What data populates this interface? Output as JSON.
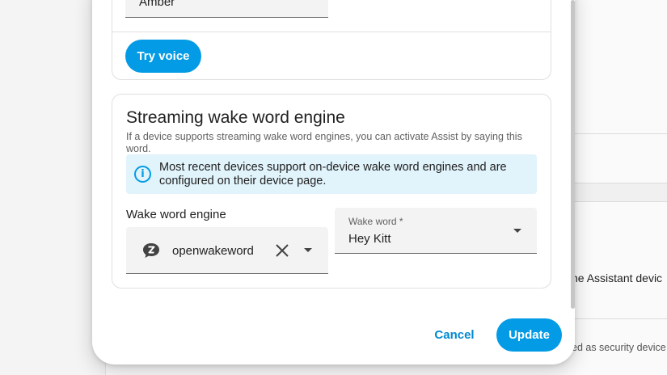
{
  "background": {
    "text_device": "ne Assistant devic",
    "text_security": "ed as security device"
  },
  "voice_section": {
    "voice_value": "Amber",
    "try_voice_label": "Try voice"
  },
  "wake_section": {
    "title": "Streaming wake word engine",
    "description": "If a device supports streaming wake word engines, you can activate Assist by saying this word.",
    "info_text": "Most recent devices support on-device wake word engines and are configured on their device page.",
    "engine_label": "Wake word engine",
    "engine_value": "openwakeword",
    "wake_word_label": "Wake word *",
    "wake_word_value": "Hey Kitt"
  },
  "actions": {
    "cancel_label": "Cancel",
    "update_label": "Update"
  },
  "colors": {
    "accent": "#039be5",
    "info_background": "#e1f3fb"
  },
  "icons": {
    "info": "info-circle-icon",
    "engine": "openwakeword-icon",
    "clear": "close-icon",
    "dropdown": "arrow-drop-down-icon"
  }
}
